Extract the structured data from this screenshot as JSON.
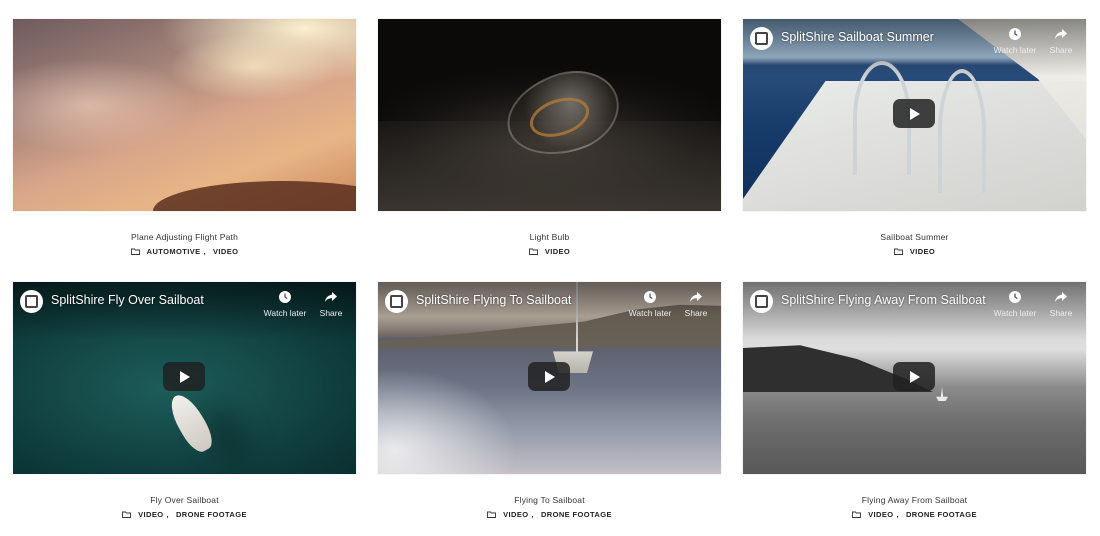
{
  "cards": [
    {
      "title": "Plane Adjusting Flight Path",
      "categories": [
        "AUTOMOTIVE",
        "VIDEO"
      ],
      "youtube": null
    },
    {
      "title": "Light Bulb",
      "categories": [
        "VIDEO"
      ],
      "youtube": null
    },
    {
      "title": "Sailboat Summer",
      "categories": [
        "VIDEO"
      ],
      "youtube": {
        "title": "SplitShire Sailboat Summer",
        "watch_later": "Watch later",
        "share": "Share"
      }
    },
    {
      "title": "Fly Over Sailboat",
      "categories": [
        "VIDEO",
        "DRONE FOOTAGE"
      ],
      "youtube": {
        "title": "SplitShire Fly Over Sailboat",
        "watch_later": "Watch later",
        "share": "Share"
      }
    },
    {
      "title": "Flying To Sailboat",
      "categories": [
        "VIDEO",
        "DRONE FOOTAGE"
      ],
      "youtube": {
        "title": "SplitShire Flying To Sailboat",
        "watch_later": "Watch later",
        "share": "Share"
      }
    },
    {
      "title": "Flying Away From Sailboat",
      "categories": [
        "VIDEO",
        "DRONE FOOTAGE"
      ],
      "youtube": {
        "title": "SplitShire Flying Away From Sailboat",
        "watch_later": "Watch later",
        "share": "Share"
      }
    }
  ],
  "separator": ",",
  "icons": {
    "category": "folder-icon",
    "channel": "splitshire-logo-icon",
    "watch_later": "clock-icon",
    "share": "share-arrow-icon",
    "play": "play-icon"
  }
}
